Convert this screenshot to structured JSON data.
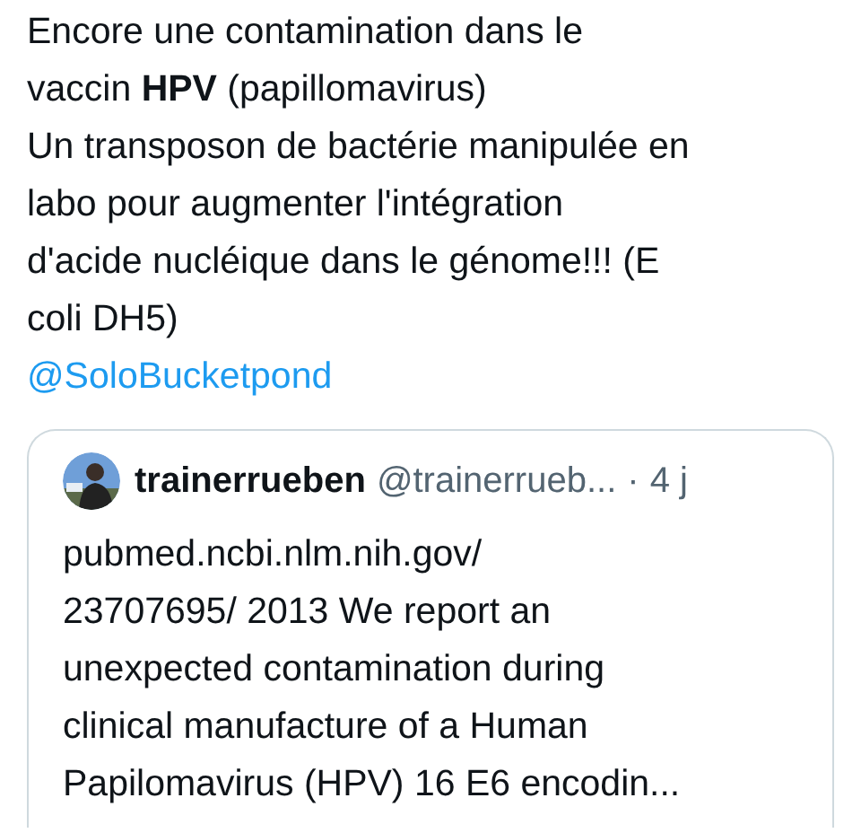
{
  "tweet": {
    "paragraphs": [
      "Encore une contamination dans le\nvaccin **HPV** (papillomavirus)",
      "Un transposon de bactérie manipulée en\nlabo pour augmenter l'intégration\nd'acide nucléique dans le génome!!! (E\ncoli DH5)"
    ],
    "mention": "@SoloBucketpond"
  },
  "quoted_tweet": {
    "author_name": "trainerrueben",
    "handle": "@trainerrueb...",
    "separator": "·",
    "time": "4 j",
    "text": "pubmed.ncbi.nlm.nih.gov/\n23707695/ 2013 We report an\nunexpected contamination during\nclinical manufacture of a Human\nPapilomavirus (HPV) 16 E6 encodin..."
  }
}
